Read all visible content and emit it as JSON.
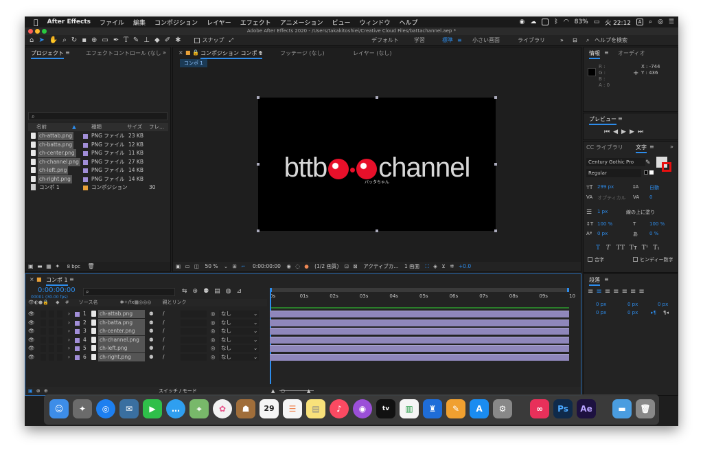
{
  "menubar": {
    "apple": "",
    "app": "After Effects",
    "items": [
      "ファイル",
      "編集",
      "コンポジション",
      "レイヤー",
      "エフェクト",
      "アニメーション",
      "ビュー",
      "ウィンドウ",
      "ヘルプ"
    ],
    "battery": "83%",
    "clock": "火 22:12",
    "input_source": "A"
  },
  "titlebar": {
    "title": "Adobe After Effects 2020 - /Users/takakitoshiei/Creative Cloud Files/battachannel.aep *"
  },
  "toolbar": {
    "snap_label": "スナップ",
    "workspaces": [
      "デフォルト",
      "学習",
      "標準",
      "小さい画面",
      "ライブラリ"
    ],
    "search_placeholder": "ヘルプを検索",
    "more": "»"
  },
  "project": {
    "tabs": [
      "プロジェクト",
      "エフェクトコントロール (なし"
    ],
    "search_icon": "⌕",
    "columns": [
      "名前",
      "種類",
      "サイズ",
      "フレ..."
    ],
    "items": [
      {
        "name": "ch-attab.png",
        "type": "PNG ファイル",
        "size": "23 KB"
      },
      {
        "name": "ch-batta.png",
        "type": "PNG ファイル",
        "size": "12 KB"
      },
      {
        "name": "ch-center.png",
        "type": "PNG ファイル",
        "size": "11 KB"
      },
      {
        "name": "ch-channel.png",
        "type": "PNG ファイル",
        "size": "27 KB"
      },
      {
        "name": "ch-left.png",
        "type": "PNG ファイル",
        "size": "14 KB"
      },
      {
        "name": "ch-right.png",
        "type": "PNG ファイル",
        "size": "14 KB"
      },
      {
        "name": "コンポ 1",
        "type": "コンポジション",
        "size": "",
        "fps": "30"
      }
    ],
    "bpc": "8 bpc"
  },
  "viewer": {
    "tabs": [
      "コンポジション コンポ 1",
      "フッテージ (なし)",
      "レイヤー (なし)"
    ],
    "comp_label": "コンポ 1",
    "logo_text_left": "bttb",
    "logo_text_right": "channel",
    "logo_sub": "バッタちゃん",
    "zoom": "50 %",
    "timecode": "0:00:00:00",
    "resolution": "(1/2 画質)",
    "camera": "アクティブカ...",
    "views": "1 画面",
    "exposure": "+0.0"
  },
  "info": {
    "tabs": [
      "情報",
      "オーディオ"
    ],
    "r": "R :",
    "g": "G :",
    "b": "B :",
    "a": "A : 0",
    "x": "X : -744",
    "y": "Y : 436"
  },
  "preview": {
    "title": "プレビュー"
  },
  "character": {
    "tabs": [
      "CC ライブラリ",
      "文字"
    ],
    "font": "Century Gothic Pro",
    "style": "Regular",
    "size": "299 px",
    "leading": "自動",
    "kerning": "オプティカル",
    "tracking": "0",
    "stroke": "1 px",
    "stroke_mode": "線の上に塗り",
    "vscale": "100 %",
    "hscale": "100 %",
    "baseline": "0 px",
    "tsume": "0 %",
    "ligature": "合字",
    "hindi": "ヒンディー数字"
  },
  "paragraph": {
    "title": "段落",
    "indent_values": [
      "0 px",
      "0 px",
      "0 px",
      "0 px",
      "0 px"
    ]
  },
  "timeline": {
    "tab": "コンポ 1",
    "timecode": "0:00:00:00",
    "fps": "00001 (30.00 fps)",
    "col_source": "ソース名",
    "col_parent": "親とリンク",
    "switch_mode": "スイッチ / モード",
    "ruler": [
      "0s",
      "01s",
      "02s",
      "03s",
      "04s",
      "05s",
      "06s",
      "07s",
      "08s",
      "09s",
      "10"
    ],
    "layers": [
      {
        "num": "1",
        "name": "ch-attab.png",
        "parent": "なし"
      },
      {
        "num": "2",
        "name": "ch-batta.png",
        "parent": "なし"
      },
      {
        "num": "3",
        "name": "ch-center.png",
        "parent": "なし"
      },
      {
        "num": "4",
        "name": "ch-channel.png",
        "parent": "なし"
      },
      {
        "num": "5",
        "name": "ch-left.png",
        "parent": "なし"
      },
      {
        "num": "6",
        "name": "ch-right.png",
        "parent": "なし"
      }
    ]
  },
  "dock": {
    "calendar_day": "29",
    "ps": "Ps",
    "ae": "Ae",
    "tv": "tv"
  },
  "colors": {
    "accent": "#2d8ceb",
    "layer_bar": "#8f87bb",
    "label": "#a18ed8"
  }
}
